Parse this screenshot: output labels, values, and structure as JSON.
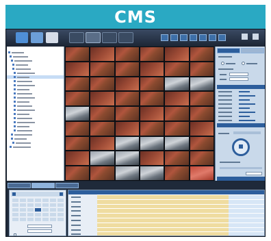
{
  "banner": {
    "title": "CMS"
  },
  "colors": {
    "banner": "#2aa9c3",
    "app_dark": "#1b2533",
    "panel": "#c9d9ea",
    "accent_blue": "#2d5e9c",
    "schedule_record": "#efdca0",
    "schedule_free": "#d7e6f6"
  },
  "toolbar": {
    "left_icons": [
      "camera-icon",
      "record-icon",
      "playback-icon"
    ],
    "mode_icons": [
      "live-view-icon",
      "ptz-icon",
      "settings-icon",
      "log-icon"
    ],
    "layout_icons": [
      "layout-1-icon",
      "layout-4-icon",
      "layout-9-icon",
      "layout-16-icon",
      "layout-25-icon",
      "layout-36-icon",
      "fullscreen-icon"
    ],
    "window_icons": [
      "minimize-icon",
      "close-icon"
    ]
  },
  "video_grid": {
    "rows": 9,
    "cols": 6
  },
  "schedule": {
    "record_fraction": 0.78
  }
}
